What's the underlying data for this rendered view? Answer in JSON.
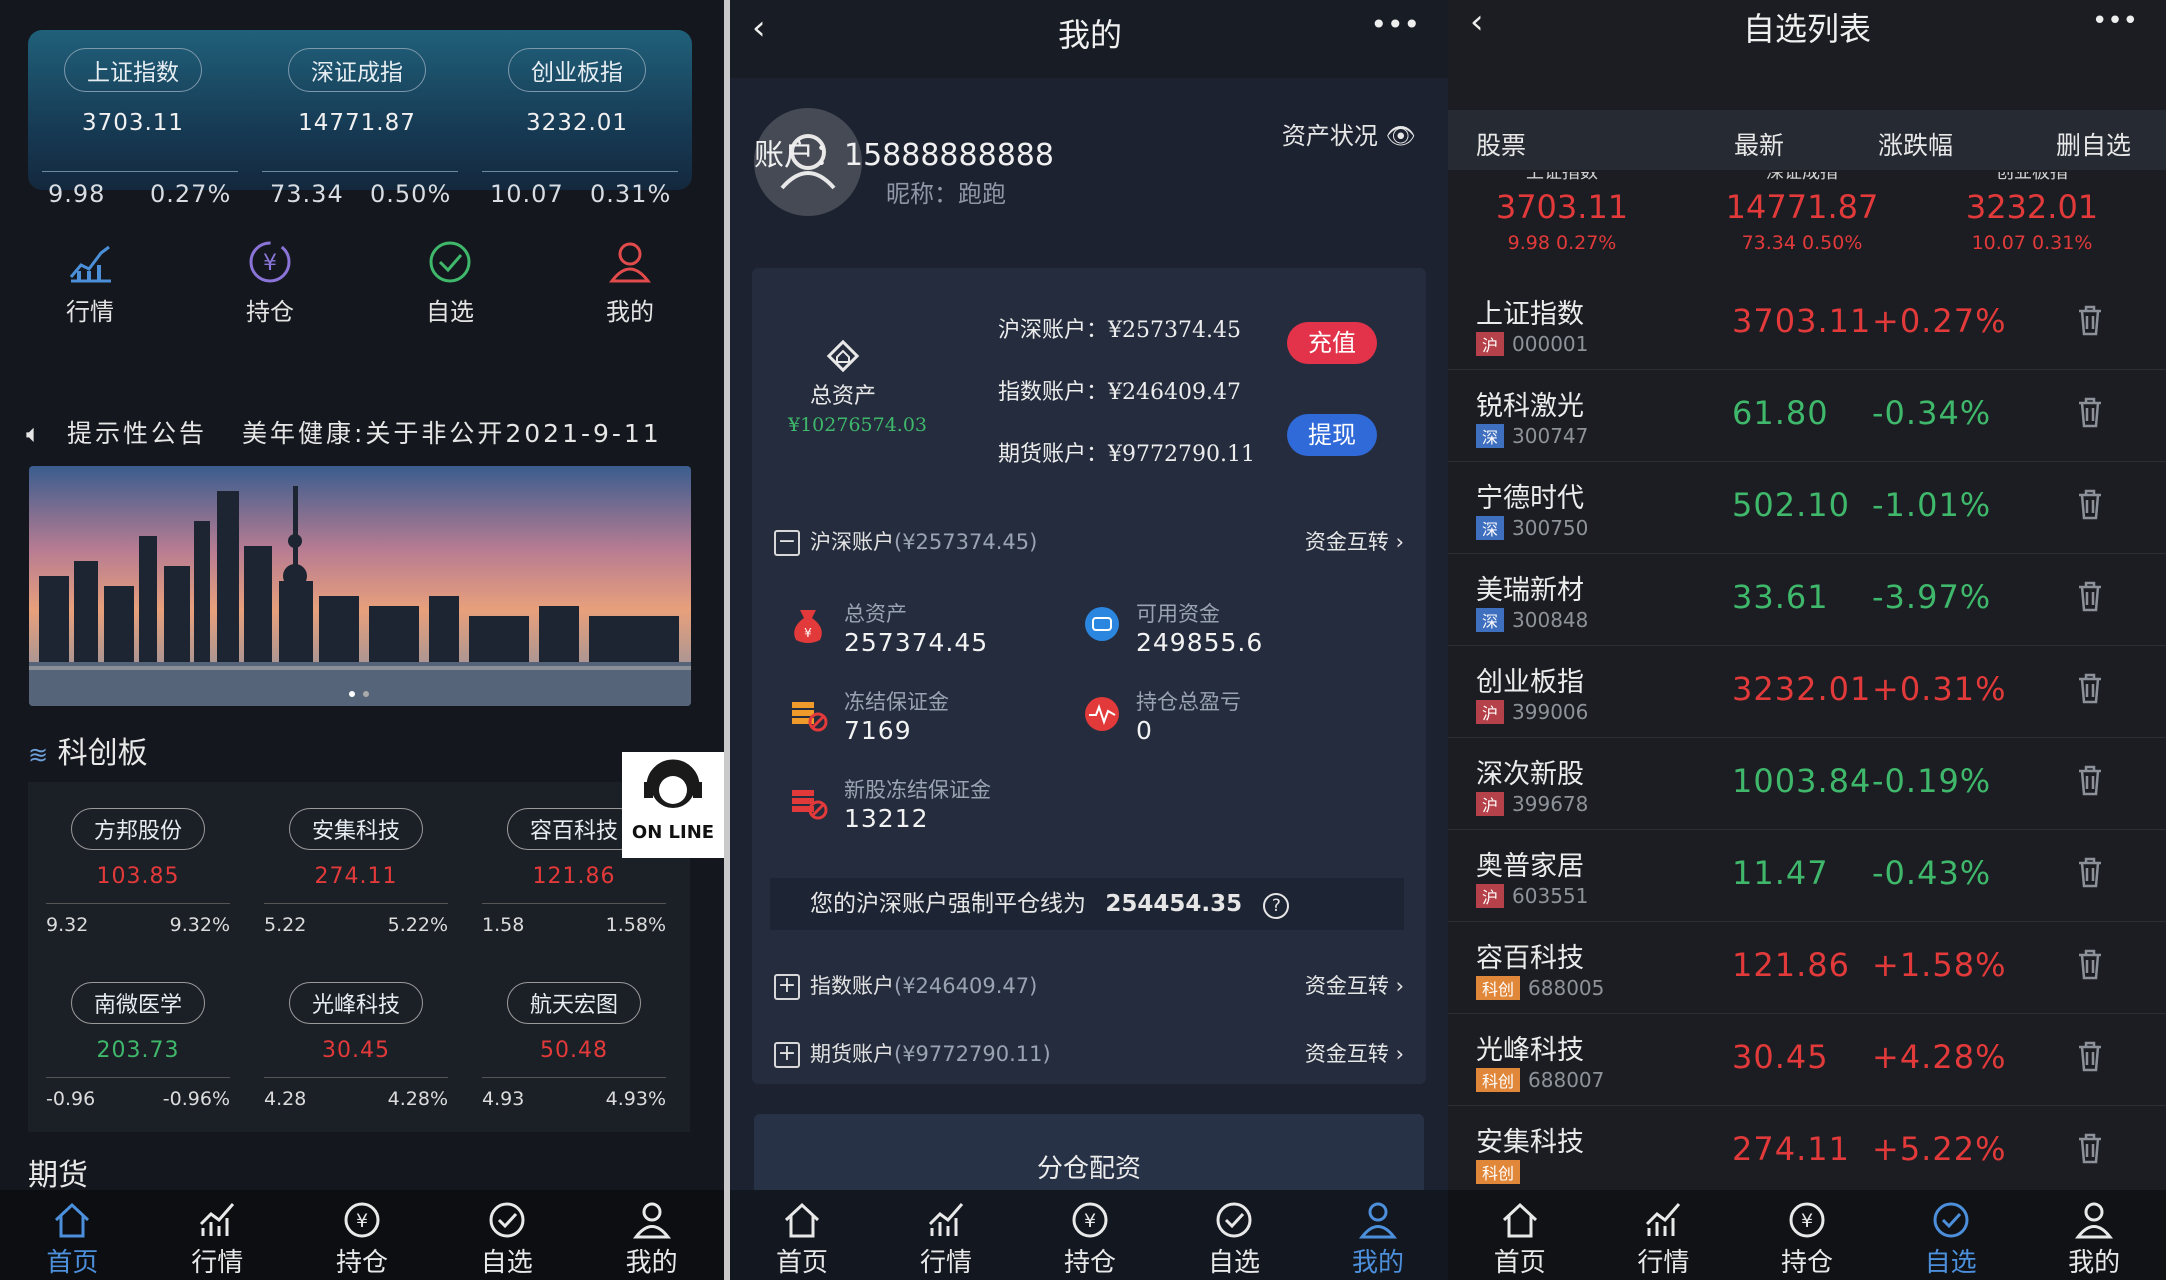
{
  "home": {
    "indices": [
      {
        "name": "上证指数",
        "value": "3703.11",
        "chg": "9.98",
        "pct": "0.27%"
      },
      {
        "name": "深证成指",
        "value": "14771.87",
        "chg": "73.34",
        "pct": "0.50%"
      },
      {
        "name": "创业板指",
        "value": "3232.01",
        "chg": "10.07",
        "pct": "0.31%"
      }
    ],
    "quicknav": [
      "行情",
      "持仓",
      "自选",
      "我的"
    ],
    "notice": "提示性公告",
    "notice_text": "美年健康:关于非公开2021-9-11",
    "section": "科创板",
    "stocks": [
      {
        "name": "方邦股份",
        "price": "103.85",
        "chg": "9.32",
        "pct": "9.32%",
        "color": "red"
      },
      {
        "name": "安集科技",
        "price": "274.11",
        "chg": "5.22",
        "pct": "5.22%",
        "color": "red"
      },
      {
        "name": "容百科技",
        "price": "121.86",
        "chg": "1.58",
        "pct": "1.58%",
        "color": "red"
      },
      {
        "name": "南微医学",
        "price": "203.73",
        "chg": "-0.96",
        "pct": "-0.96%",
        "color": "green"
      },
      {
        "name": "光峰科技",
        "price": "30.45",
        "chg": "4.28",
        "pct": "4.28%",
        "color": "red"
      },
      {
        "name": "航天宏图",
        "price": "50.48",
        "chg": "4.93",
        "pct": "4.93%",
        "color": "red"
      }
    ],
    "next_section": "期货",
    "online": "ON LINE"
  },
  "tabs": [
    "首页",
    "行情",
    "持仓",
    "自选",
    "我的"
  ],
  "mine": {
    "title": "我的",
    "account_label": "账户：",
    "account": "15888888888",
    "nick_label": "昵称：",
    "nick": "跑跑",
    "asset_status": "资产状况",
    "total_label": "总资产",
    "total": "¥10276574.03",
    "hs": "沪深账户：¥257374.45",
    "idx": "指数账户：¥246409.47",
    "fut": "期货账户：¥9772790.11",
    "recharge": "充值",
    "withdraw": "提现",
    "hs_row": "沪深账户",
    "hs_row_amt": "(¥257374.45)",
    "transfer": "资金互转",
    "d_total_label": "总资产",
    "d_total": "257374.45",
    "d_avail_label": "可用资金",
    "d_avail": "249855.6",
    "d_frozen_label": "冻结保证金",
    "d_frozen": "7169",
    "d_pl_label": "持仓总盈亏",
    "d_pl": "0",
    "d_new_label": "新股冻结保证金",
    "d_new": "13212",
    "liq_text": "您的沪深账户强制平仓线为",
    "liq_val": "254454.35",
    "idx_row": "指数账户",
    "idx_row_amt": "(¥246409.47)",
    "fut_row": "期货账户",
    "fut_row_amt": "(¥9772790.11)",
    "alloc": "分仓配资"
  },
  "watch": {
    "title": "自选列表",
    "cols": [
      "股票",
      "最新",
      "涨跌幅",
      "删自选"
    ],
    "quotes": [
      {
        "name": "上证指数",
        "value": "3703.11",
        "sub": "9.98 0.27%"
      },
      {
        "name": "深证成指",
        "value": "14771.87",
        "sub": "73.34 0.50%"
      },
      {
        "name": "创业板指",
        "value": "3232.01",
        "sub": "10.07 0.31%"
      }
    ],
    "items": [
      {
        "name": "上证指数",
        "mkt": "沪",
        "code": "000001",
        "price": "3703.11",
        "pct": "+0.27%",
        "up": true
      },
      {
        "name": "锐科激光",
        "mkt": "深",
        "code": "300747",
        "price": "61.80",
        "pct": "-0.34%",
        "up": false
      },
      {
        "name": "宁德时代",
        "mkt": "深",
        "code": "300750",
        "price": "502.10",
        "pct": "-1.01%",
        "up": false
      },
      {
        "name": "美瑞新材",
        "mkt": "深",
        "code": "300848",
        "price": "33.61",
        "pct": "-3.97%",
        "up": false
      },
      {
        "name": "创业板指",
        "mkt": "沪",
        "code": "399006",
        "price": "3232.01",
        "pct": "+0.31%",
        "up": true
      },
      {
        "name": "深次新股",
        "mkt": "沪",
        "code": "399678",
        "price": "1003.84",
        "pct": "-0.19%",
        "up": false
      },
      {
        "name": "奥普家居",
        "mkt": "沪",
        "code": "603551",
        "price": "11.47",
        "pct": "-0.43%",
        "up": false
      },
      {
        "name": "容百科技",
        "mkt": "科创",
        "code": "688005",
        "price": "121.86",
        "pct": "+1.58%",
        "up": true
      },
      {
        "name": "光峰科技",
        "mkt": "科创",
        "code": "688007",
        "price": "30.45",
        "pct": "+4.28%",
        "up": true
      },
      {
        "name": "安集科技",
        "mkt": "科创",
        "code": "",
        "price": "274.11",
        "pct": "+5.22%",
        "up": true
      }
    ]
  },
  "colors": {
    "up": "#e23a3a",
    "down": "#3fb86b",
    "accent": "#4c8fdb"
  }
}
